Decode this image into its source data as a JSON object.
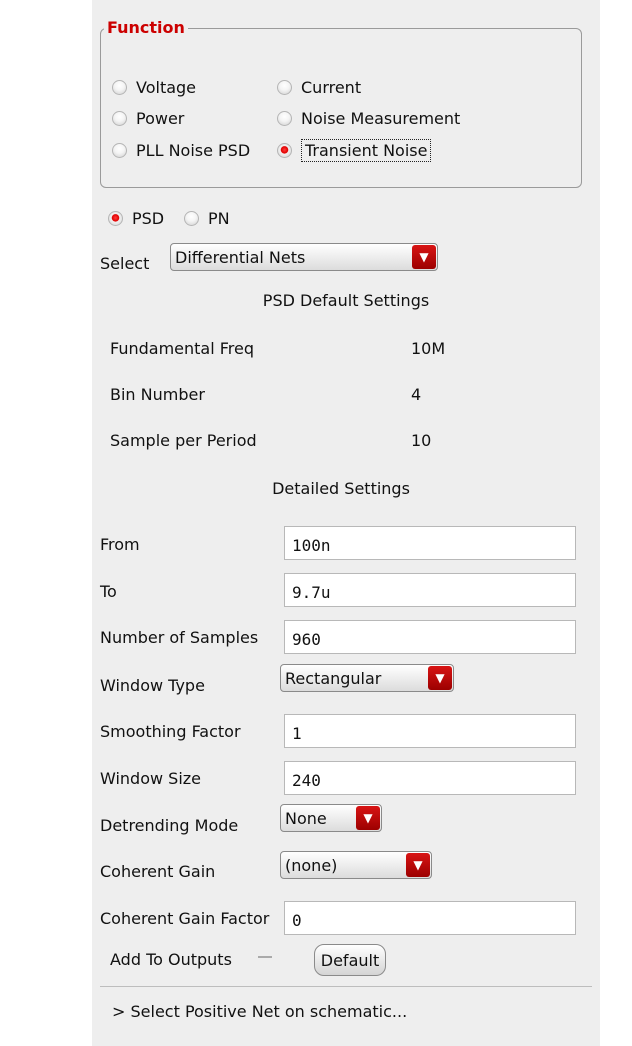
{
  "function_group": {
    "title": "Function",
    "options": [
      {
        "label": "Voltage",
        "selected": false
      },
      {
        "label": "Current",
        "selected": false
      },
      {
        "label": "Power",
        "selected": false
      },
      {
        "label": "Noise Measurement",
        "selected": false
      },
      {
        "label": "PLL Noise PSD",
        "selected": false
      },
      {
        "label": "Transient Noise",
        "selected": true
      }
    ]
  },
  "mode": {
    "options": [
      {
        "label": "PSD",
        "selected": true
      },
      {
        "label": "PN",
        "selected": false
      }
    ]
  },
  "select": {
    "label": "Select",
    "value": "Differential Nets"
  },
  "psd_defaults": {
    "heading": "PSD Default Settings",
    "rows": [
      {
        "label": "Fundamental Freq",
        "value": "10M"
      },
      {
        "label": "Bin Number",
        "value": "4"
      },
      {
        "label": "Sample per Period",
        "value": "10"
      }
    ]
  },
  "detailed": {
    "heading": "Detailed Settings",
    "from": {
      "label": "From",
      "value": "100n"
    },
    "to": {
      "label": "To",
      "value": "9.7u"
    },
    "num_samples": {
      "label": "Number of Samples",
      "value": "960"
    },
    "window_type": {
      "label": "Window Type",
      "value": "Rectangular"
    },
    "smoothing": {
      "label": "Smoothing Factor",
      "value": "1"
    },
    "window_size": {
      "label": "Window Size",
      "value": "240"
    },
    "detrending": {
      "label": "Detrending Mode",
      "value": "None"
    },
    "coherent_gain": {
      "label": "Coherent Gain",
      "value": "(none)"
    },
    "coherent_gain_factor": {
      "label": "Coherent Gain Factor",
      "value": "0"
    }
  },
  "outputs": {
    "add_label": "Add To Outputs",
    "add_checked": false,
    "default_button": "Default"
  },
  "status": {
    "text": "> Select Positive Net on schematic..."
  },
  "colors": {
    "accent": "#cc0000",
    "panel_bg": "#eeeeee",
    "dropdown_arrow": "#c40000"
  },
  "icons": {
    "dropdown": "chevron-down-icon",
    "radio_on": "radio-selected-icon",
    "radio_off": "radio-unselected-icon"
  }
}
